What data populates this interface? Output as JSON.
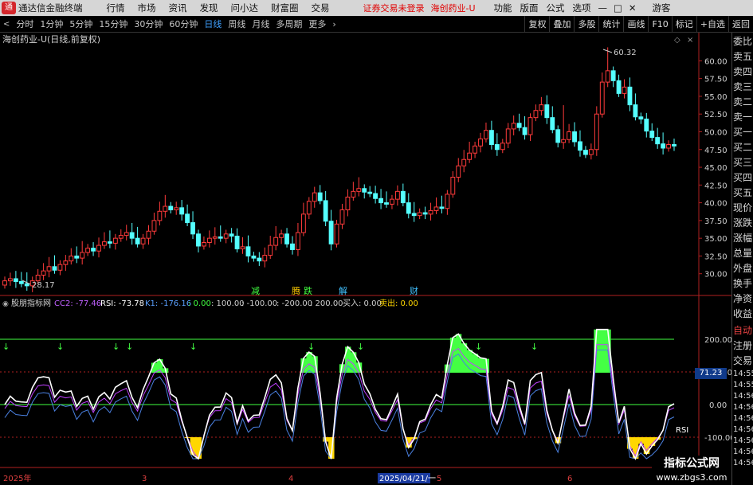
{
  "menubar": {
    "logo": "通",
    "app_title": "通达信金融终端",
    "items": [
      "行情",
      "市场",
      "资讯",
      "发现",
      "问小达",
      "财富圈",
      "交易"
    ],
    "notice": "证券交易未登录",
    "stock": "海创药业-U",
    "right_items": [
      "功能",
      "版面",
      "公式",
      "选项"
    ],
    "guest": "游客",
    "window_buttons": [
      "—",
      "□",
      "✕"
    ]
  },
  "toolbar": {
    "periods": [
      "分时",
      "1分钟",
      "5分钟",
      "15分钟",
      "30分钟",
      "60分钟",
      "日线",
      "周线",
      "月线",
      "多周期",
      "更多"
    ],
    "active": "日线",
    "right": [
      "复权",
      "叠加",
      "多股",
      "统计",
      "画线",
      "F10",
      "标记",
      "+自选",
      "返回"
    ]
  },
  "main": {
    "title": "海创药业-U(日线,前复权)",
    "high_label": "60.32",
    "low_label": "28.17",
    "yticks": [
      "60.00",
      "57.50",
      "55.00",
      "52.50",
      "50.00",
      "47.50",
      "45.00",
      "42.50",
      "40.00",
      "37.50",
      "35.00",
      "32.50",
      "30.00"
    ],
    "events": [
      {
        "t": "减",
        "c": "#40ff40"
      },
      {
        "t": "腾",
        "c": "#ffcc00"
      },
      {
        "t": "跌",
        "c": "#40ff40"
      },
      {
        "t": "解",
        "c": "#40c0ff"
      },
      {
        "t": "财",
        "c": "#40c0ff"
      }
    ]
  },
  "sub": {
    "name": "股朋指标网",
    "cc2": "CC2: -77.46",
    "rsi": "RSI: -73.78",
    "k1": "K1: -176.16",
    "v0": ": 0.00",
    "v100": ": 100.00",
    "vm100": ": -100.00",
    "vm200": ": -200.00",
    "v200": ": 200.00",
    "buy": "买入: 0.00",
    "sell": "卖出: 0.00",
    "yticks": [
      "200.00",
      "100.00",
      "0.00",
      "-100.00"
    ],
    "axis_value": "71.23",
    "rsi_label": "RSI"
  },
  "dates": [
    "2025年",
    "3",
    "4",
    "2025/04/21/一",
    "5",
    "6"
  ],
  "sidebar": [
    "委比",
    "卖五",
    "卖四",
    "卖三",
    "卖二",
    "卖一",
    "买一",
    "买二",
    "买三",
    "买四",
    "买五",
    "现价",
    "涨跌",
    "涨幅",
    "总量",
    "外盘",
    "换手",
    "净资",
    "收益",
    "自动",
    "注册",
    "交易",
    "14:55",
    "14:55",
    "14:56",
    "14:56",
    "14:56",
    "14:56",
    "14:56",
    "14:56",
    "14:56"
  ],
  "watermark": {
    "title": "指标公式网",
    "url": "www.zbgs3.com"
  },
  "chart_data": {
    "type": "candlestick",
    "title": "海创药业-U(日线,前复权)",
    "ylim": [
      27.5,
      61.5
    ],
    "high": 60.32,
    "low": 28.17,
    "closes": [
      29,
      29.3,
      28.9,
      28.6,
      28.3,
      29.0,
      29.8,
      30.4,
      31.0,
      30.5,
      31.3,
      31.8,
      32.5,
      32.2,
      33.0,
      33.6,
      33.2,
      34.0,
      34.5,
      34.3,
      35.0,
      35.4,
      35.8,
      35.0,
      34.2,
      35.0,
      36.0,
      37.5,
      38.8,
      39.5,
      39.0,
      39.3,
      38.4,
      37.2,
      35.6,
      33.9,
      34.4,
      35.0,
      35.2,
      35.0,
      35.6,
      35.3,
      33.5,
      33.8,
      32.5,
      32.2,
      31.8,
      32.6,
      34.0,
      35.1,
      35.6,
      34.2,
      33.4,
      35.8,
      38.4,
      40.2,
      41.4,
      40.3,
      37.4,
      34.2,
      37.0,
      39.0,
      40.8,
      41.6,
      42.0,
      41.5,
      41.3,
      40.6,
      40.0,
      39.8,
      40.5,
      41.6,
      40.0,
      38.5,
      38.2,
      38.6,
      38.4,
      38.9,
      39.4,
      39.2,
      41.2,
      43.6,
      45.2,
      46.1,
      47.0,
      48.0,
      49.0,
      50.2,
      48.2,
      47.5,
      48.4,
      50.4,
      51.2,
      50.6,
      49.6,
      52.0,
      53.0,
      53.8,
      52.0,
      50.3,
      48.5,
      48.9,
      50.0,
      48.6,
      47.4,
      46.8,
      47.5,
      52.5,
      57.0,
      58.6,
      57.2,
      55.4,
      56.3,
      53.8,
      52.1,
      51.8,
      50.1,
      49.2,
      48.3,
      47.7,
      48.2,
      48.0
    ],
    "opens": [
      28.4,
      29,
      29.3,
      28.9,
      28.6,
      28.3,
      29,
      29.8,
      30.4,
      31,
      30.5,
      31.3,
      31.8,
      32.5,
      32.2,
      33,
      33.6,
      33.2,
      34,
      34.5,
      34.3,
      35,
      35.4,
      35.8,
      35,
      34.2,
      35,
      36,
      37.5,
      38.8,
      39.5,
      39,
      39.3,
      38.4,
      37.2,
      35.6,
      33.9,
      34.4,
      35,
      35.2,
      35,
      35.6,
      35.3,
      33.5,
      33.8,
      32.5,
      32.2,
      31.8,
      32.6,
      34,
      35.1,
      35.6,
      34.2,
      33.4,
      35.8,
      38.4,
      40.2,
      41.4,
      40.3,
      37.4,
      34.2,
      37,
      39,
      40.8,
      41.6,
      42,
      41.5,
      41.3,
      40.6,
      40,
      39.8,
      40.5,
      41.6,
      40,
      38.5,
      38.2,
      38.6,
      38.4,
      38.9,
      39.4,
      39.2,
      41.2,
      43.6,
      45.2,
      46.1,
      47,
      48,
      49,
      50.2,
      48.2,
      47.5,
      48.4,
      50.4,
      51.2,
      50.6,
      49.6,
      52,
      53,
      53.8,
      52,
      50.3,
      48.5,
      48.9,
      50,
      48.6,
      47.4,
      46.8,
      47.5,
      52.5,
      57,
      58.6,
      57.2,
      55.4,
      56.3,
      53.8,
      52.1,
      51.8,
      50.1,
      49.2,
      48.3,
      47.7,
      48.2
    ]
  }
}
